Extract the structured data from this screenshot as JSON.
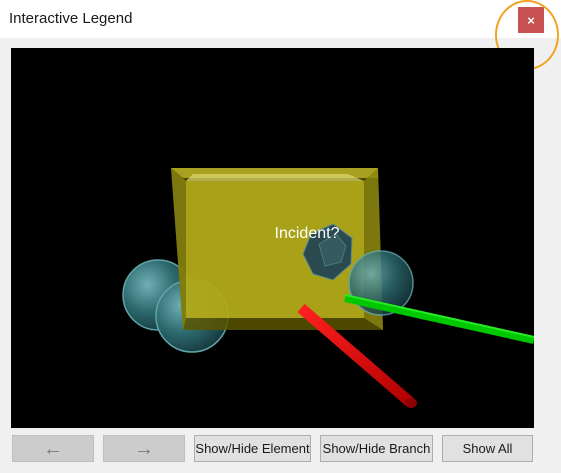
{
  "window": {
    "title": "Interactive Legend",
    "close_label": "×"
  },
  "scene": {
    "label": "Incident?"
  },
  "toolbar": {
    "back_label": "←",
    "forward_label": "→",
    "show_hide_element": "Show/Hide Element",
    "show_hide_branch": "Show/Hide Branch",
    "show_all": "Show All"
  },
  "colors": {
    "close_button": "#c75050",
    "highlight_ring": "#f0a422",
    "cube": "#c8c020",
    "sphere": "#3a7a80",
    "red_rod": "#e00000",
    "green_rod": "#00c800"
  },
  "icons": {
    "back": "arrow-left-icon",
    "forward": "arrow-right-icon",
    "close": "close-icon"
  }
}
